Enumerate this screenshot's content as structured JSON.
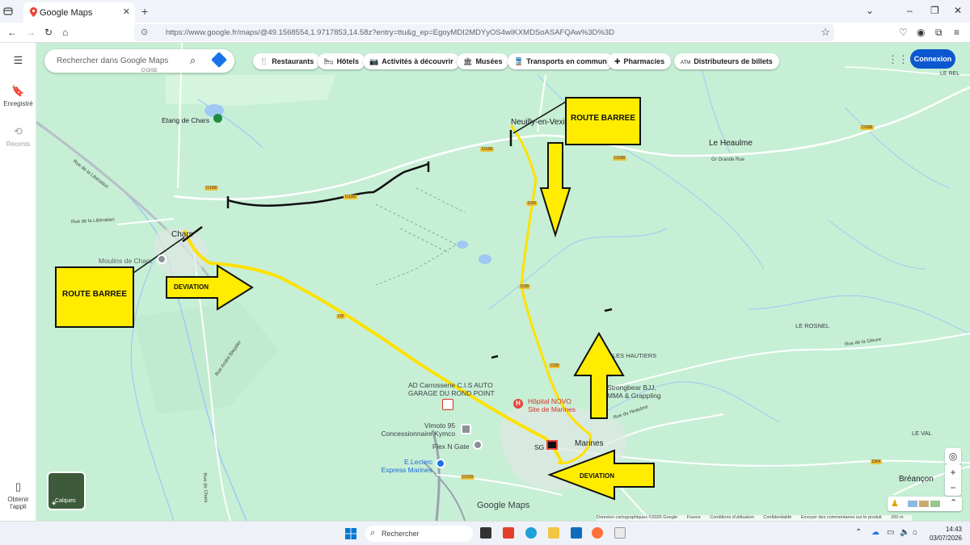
{
  "browser": {
    "tab_title": "Google Maps",
    "tab_close": "✕",
    "new_tab": "+",
    "url": "https://www.google.fr/maps/@49.1568554,1.9717853,14.58z?entry=ttu&g_ep=EgoyMDI2MDYyOS4wIKXMDSoASAFQAw%3D%3D"
  },
  "sidebar": {
    "saved": "Enregistré",
    "recent": "Récents",
    "get_app": "Obtenir l'appli"
  },
  "search": {
    "placeholder": "Rechercher dans Google Maps"
  },
  "chips": [
    {
      "icon": "🍴",
      "label": "Restaurants"
    },
    {
      "icon": "🛏",
      "label": "Hôtels"
    },
    {
      "icon": "📷",
      "label": "Activités à découvrir"
    },
    {
      "icon": "🏛",
      "label": "Musées"
    },
    {
      "icon": "🚆",
      "label": "Transports en commun"
    },
    {
      "icon": "✚",
      "label": "Pharmacies"
    },
    {
      "icon": "ATM",
      "label": "Distributeurs de billets"
    }
  ],
  "connexion": "Connexion",
  "map": {
    "places": {
      "etang": "Etang de Chars",
      "neuilly": "Neuilly-en-Vexin",
      "le_heaulme": "Le Heaulme",
      "chars": "Chars",
      "moulins": "Moulins de Chars",
      "le_rel": "LE REL",
      "le_rosnel": "LE ROSNEL",
      "les_hautiers": "LES HAUTIERS",
      "le_val": "LE VAL",
      "breancon": "Bréançon",
      "marines": "Marines",
      "sg": "SG",
      "d_oise": "D'OISE"
    },
    "streets": {
      "rue_liberation": "Rue de la Libération",
      "rue_lib_diag": "Rue de la Libération",
      "gr_grande_rue": "Gr Grande Rue",
      "rue_gleure": "Rue de la Gleure",
      "rue_heaulme": "Rue du Heaulme",
      "rue_chars": "Rue de Chars",
      "rue_andre": "Rue André Bleydier"
    },
    "roads": {
      "d188a": "D188",
      "d188b": "D188",
      "d188c": "D188",
      "d188d": "D188",
      "d188e": "D188",
      "d26": "D26",
      "d28a": "D28",
      "d28b": "D28",
      "d64": "D64",
      "d159": "D159",
      "d915": "D9"
    },
    "pois": {
      "ad_line1": "AD Carrosserie C.I.S AUTO",
      "ad_line2": "GARAGE DU ROND POINT",
      "hopital_line1": "Hôpital NOVO",
      "hopital_line2": "Site de Marines",
      "strongbear_line1": "Strongbear BJJ,",
      "strongbear_line2": "MMA & Grappling",
      "vimoto_line1": "Vimoto 95",
      "vimoto_line2": "Concessionnaire Kymco",
      "flex": "Flex N Gate",
      "leclerc_line1": "E.Leclerc",
      "leclerc_line2": "Express Marines"
    },
    "annotations": {
      "route_barree_left": "ROUTE BARREE",
      "route_barree_right": "ROUTE BARREE",
      "deviation_left": "DEVIATION",
      "deviation_bottom": "DEVIATION"
    },
    "layers": "Calques",
    "logo": "Google Maps",
    "attribution": [
      "Données cartographiques ©2026 Google",
      "France",
      "Conditions d'utilisation",
      "Confidentialité",
      "Envoyer des commentaires sur le produit",
      "200 m"
    ]
  },
  "taskbar": {
    "search_placeholder": "Rechercher",
    "time": "14:43",
    "date": "03/07/2026"
  },
  "colors": {
    "map_bg": "#c7efd6",
    "annotation_yellow": "#ffec00",
    "route_yellow": "#ffe100",
    "accent_blue": "#0b57d0"
  }
}
